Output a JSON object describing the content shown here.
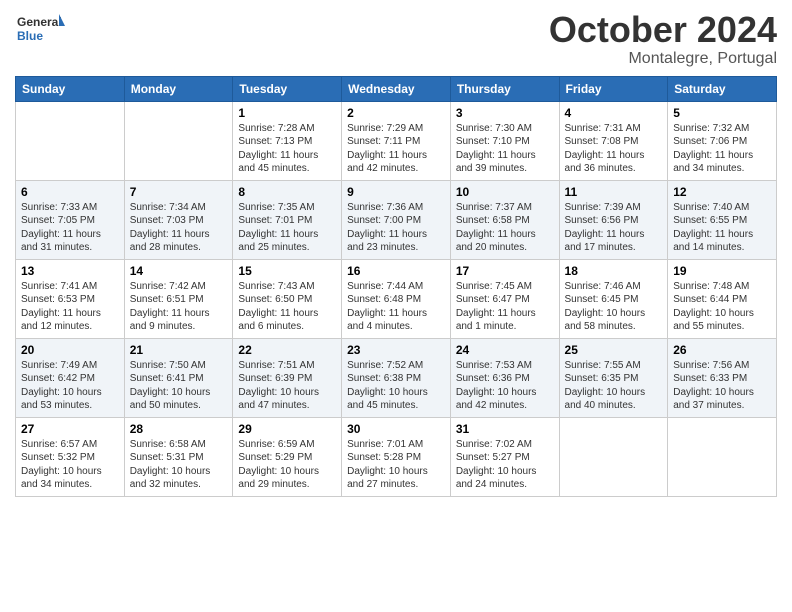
{
  "header": {
    "logo_general": "General",
    "logo_blue": "Blue",
    "month": "October 2024",
    "location": "Montalegre, Portugal"
  },
  "days_of_week": [
    "Sunday",
    "Monday",
    "Tuesday",
    "Wednesday",
    "Thursday",
    "Friday",
    "Saturday"
  ],
  "weeks": [
    [
      {
        "day": "",
        "sunrise": "",
        "sunset": "",
        "daylight": ""
      },
      {
        "day": "",
        "sunrise": "",
        "sunset": "",
        "daylight": ""
      },
      {
        "day": "1",
        "sunrise": "Sunrise: 7:28 AM",
        "sunset": "Sunset: 7:13 PM",
        "daylight": "Daylight: 11 hours and 45 minutes."
      },
      {
        "day": "2",
        "sunrise": "Sunrise: 7:29 AM",
        "sunset": "Sunset: 7:11 PM",
        "daylight": "Daylight: 11 hours and 42 minutes."
      },
      {
        "day": "3",
        "sunrise": "Sunrise: 7:30 AM",
        "sunset": "Sunset: 7:10 PM",
        "daylight": "Daylight: 11 hours and 39 minutes."
      },
      {
        "day": "4",
        "sunrise": "Sunrise: 7:31 AM",
        "sunset": "Sunset: 7:08 PM",
        "daylight": "Daylight: 11 hours and 36 minutes."
      },
      {
        "day": "5",
        "sunrise": "Sunrise: 7:32 AM",
        "sunset": "Sunset: 7:06 PM",
        "daylight": "Daylight: 11 hours and 34 minutes."
      }
    ],
    [
      {
        "day": "6",
        "sunrise": "Sunrise: 7:33 AM",
        "sunset": "Sunset: 7:05 PM",
        "daylight": "Daylight: 11 hours and 31 minutes."
      },
      {
        "day": "7",
        "sunrise": "Sunrise: 7:34 AM",
        "sunset": "Sunset: 7:03 PM",
        "daylight": "Daylight: 11 hours and 28 minutes."
      },
      {
        "day": "8",
        "sunrise": "Sunrise: 7:35 AM",
        "sunset": "Sunset: 7:01 PM",
        "daylight": "Daylight: 11 hours and 25 minutes."
      },
      {
        "day": "9",
        "sunrise": "Sunrise: 7:36 AM",
        "sunset": "Sunset: 7:00 PM",
        "daylight": "Daylight: 11 hours and 23 minutes."
      },
      {
        "day": "10",
        "sunrise": "Sunrise: 7:37 AM",
        "sunset": "Sunset: 6:58 PM",
        "daylight": "Daylight: 11 hours and 20 minutes."
      },
      {
        "day": "11",
        "sunrise": "Sunrise: 7:39 AM",
        "sunset": "Sunset: 6:56 PM",
        "daylight": "Daylight: 11 hours and 17 minutes."
      },
      {
        "day": "12",
        "sunrise": "Sunrise: 7:40 AM",
        "sunset": "Sunset: 6:55 PM",
        "daylight": "Daylight: 11 hours and 14 minutes."
      }
    ],
    [
      {
        "day": "13",
        "sunrise": "Sunrise: 7:41 AM",
        "sunset": "Sunset: 6:53 PM",
        "daylight": "Daylight: 11 hours and 12 minutes."
      },
      {
        "day": "14",
        "sunrise": "Sunrise: 7:42 AM",
        "sunset": "Sunset: 6:51 PM",
        "daylight": "Daylight: 11 hours and 9 minutes."
      },
      {
        "day": "15",
        "sunrise": "Sunrise: 7:43 AM",
        "sunset": "Sunset: 6:50 PM",
        "daylight": "Daylight: 11 hours and 6 minutes."
      },
      {
        "day": "16",
        "sunrise": "Sunrise: 7:44 AM",
        "sunset": "Sunset: 6:48 PM",
        "daylight": "Daylight: 11 hours and 4 minutes."
      },
      {
        "day": "17",
        "sunrise": "Sunrise: 7:45 AM",
        "sunset": "Sunset: 6:47 PM",
        "daylight": "Daylight: 11 hours and 1 minute."
      },
      {
        "day": "18",
        "sunrise": "Sunrise: 7:46 AM",
        "sunset": "Sunset: 6:45 PM",
        "daylight": "Daylight: 10 hours and 58 minutes."
      },
      {
        "day": "19",
        "sunrise": "Sunrise: 7:48 AM",
        "sunset": "Sunset: 6:44 PM",
        "daylight": "Daylight: 10 hours and 55 minutes."
      }
    ],
    [
      {
        "day": "20",
        "sunrise": "Sunrise: 7:49 AM",
        "sunset": "Sunset: 6:42 PM",
        "daylight": "Daylight: 10 hours and 53 minutes."
      },
      {
        "day": "21",
        "sunrise": "Sunrise: 7:50 AM",
        "sunset": "Sunset: 6:41 PM",
        "daylight": "Daylight: 10 hours and 50 minutes."
      },
      {
        "day": "22",
        "sunrise": "Sunrise: 7:51 AM",
        "sunset": "Sunset: 6:39 PM",
        "daylight": "Daylight: 10 hours and 47 minutes."
      },
      {
        "day": "23",
        "sunrise": "Sunrise: 7:52 AM",
        "sunset": "Sunset: 6:38 PM",
        "daylight": "Daylight: 10 hours and 45 minutes."
      },
      {
        "day": "24",
        "sunrise": "Sunrise: 7:53 AM",
        "sunset": "Sunset: 6:36 PM",
        "daylight": "Daylight: 10 hours and 42 minutes."
      },
      {
        "day": "25",
        "sunrise": "Sunrise: 7:55 AM",
        "sunset": "Sunset: 6:35 PM",
        "daylight": "Daylight: 10 hours and 40 minutes."
      },
      {
        "day": "26",
        "sunrise": "Sunrise: 7:56 AM",
        "sunset": "Sunset: 6:33 PM",
        "daylight": "Daylight: 10 hours and 37 minutes."
      }
    ],
    [
      {
        "day": "27",
        "sunrise": "Sunrise: 6:57 AM",
        "sunset": "Sunset: 5:32 PM",
        "daylight": "Daylight: 10 hours and 34 minutes."
      },
      {
        "day": "28",
        "sunrise": "Sunrise: 6:58 AM",
        "sunset": "Sunset: 5:31 PM",
        "daylight": "Daylight: 10 hours and 32 minutes."
      },
      {
        "day": "29",
        "sunrise": "Sunrise: 6:59 AM",
        "sunset": "Sunset: 5:29 PM",
        "daylight": "Daylight: 10 hours and 29 minutes."
      },
      {
        "day": "30",
        "sunrise": "Sunrise: 7:01 AM",
        "sunset": "Sunset: 5:28 PM",
        "daylight": "Daylight: 10 hours and 27 minutes."
      },
      {
        "day": "31",
        "sunrise": "Sunrise: 7:02 AM",
        "sunset": "Sunset: 5:27 PM",
        "daylight": "Daylight: 10 hours and 24 minutes."
      },
      {
        "day": "",
        "sunrise": "",
        "sunset": "",
        "daylight": ""
      },
      {
        "day": "",
        "sunrise": "",
        "sunset": "",
        "daylight": ""
      }
    ]
  ]
}
